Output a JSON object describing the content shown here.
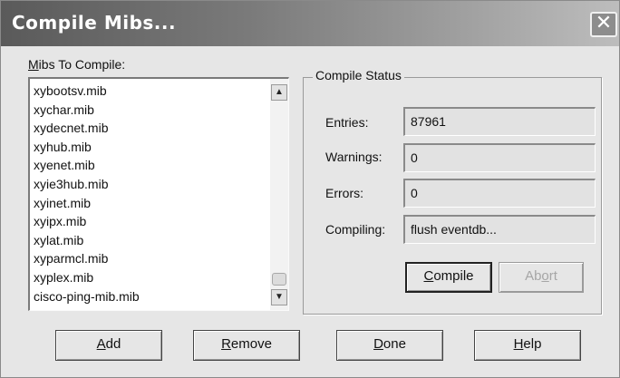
{
  "window": {
    "title": "Compile Mibs...",
    "close_symbol": "✕"
  },
  "mibs": {
    "label_mnemonic": "M",
    "label_rest": "ibs To Compile:",
    "items": [
      "xybootsv.mib",
      "xychar.mib",
      "xydecnet.mib",
      "xyhub.mib",
      "xyenet.mib",
      "xyie3hub.mib",
      "xyinet.mib",
      "xyipx.mib",
      "xylat.mib",
      "xyparmcl.mib",
      "xyplex.mib",
      "cisco-ping-mib.mib"
    ]
  },
  "status": {
    "group_label": "Compile Status",
    "entries_label": "Entries:",
    "entries_value": "87961",
    "warnings_label": "Warnings:",
    "warnings_value": "0",
    "errors_label": "Errors:",
    "errors_value": "0",
    "compiling_label": "Compiling:",
    "compiling_value": "flush eventdb..."
  },
  "buttons": {
    "compile": {
      "mn": "C",
      "rest": "ompile"
    },
    "abort": {
      "pre": "Ab",
      "mn": "o",
      "post": "rt",
      "enabled": false
    },
    "add": {
      "mn": "A",
      "rest": "dd"
    },
    "remove": {
      "mn": "R",
      "rest": "emove"
    },
    "done": {
      "mn": "D",
      "rest": "one"
    },
    "help": {
      "mn": "H",
      "rest": "elp"
    }
  },
  "icons": {
    "close": "close-icon",
    "scroll_up": "scroll-up-arrow-icon",
    "scroll_down": "scroll-down-arrow-icon"
  },
  "colors": {
    "title_bar_start": "#5a5a5a",
    "title_bar_end": "#bdbdbd",
    "dialog_bg": "#e6e6e6"
  }
}
